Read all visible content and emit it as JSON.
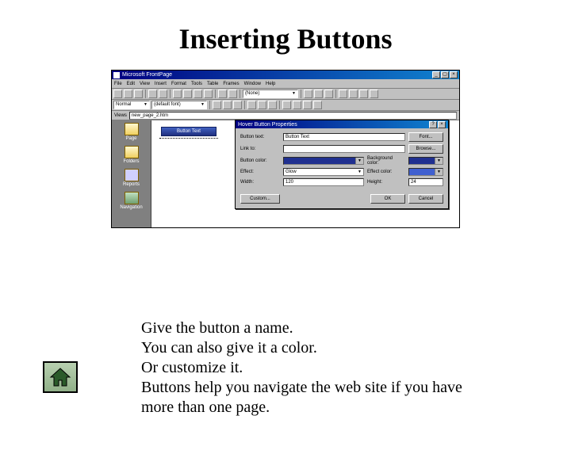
{
  "slide": {
    "title": "Inserting Buttons",
    "instructions": [
      "Give the button a name.",
      "You can also give it a color.",
      "Or customize it.",
      "Buttons help you navigate the web site if you have more than one page."
    ]
  },
  "app": {
    "title": "Microsoft FrontPage",
    "menus": [
      "File",
      "Edit",
      "View",
      "Insert",
      "Format",
      "Tools",
      "Table",
      "Frames",
      "Window",
      "Help"
    ],
    "toolbar2_dropdown": "(None)",
    "toolbar2_font": "(default font)",
    "toolbar2_size": "Normal",
    "address_label": "Views",
    "address_value": "new_page_2.htm",
    "views": [
      "Page",
      "Folders",
      "Reports",
      "Navigation"
    ],
    "button_preview_text": "Button Text"
  },
  "dialog": {
    "title": "Hover Button Properties",
    "labels": {
      "button_text": "Button text:",
      "link_to": "Link to:",
      "button_color": "Button color:",
      "background_color": "Background color:",
      "effect": "Effect:",
      "effect_color": "Effect color:",
      "width": "Width:",
      "height": "Height:"
    },
    "values": {
      "button_text": "Button Text",
      "link_to": "",
      "effect": "Glow",
      "width": "120",
      "height": "24"
    },
    "colors": {
      "button_color": "#203090",
      "background_color": "#203090",
      "effect_color": "#4060d0"
    },
    "buttons": {
      "font": "Font...",
      "browse": "Browse...",
      "custom": "Custom...",
      "ok": "OK",
      "cancel": "Cancel"
    }
  },
  "nav": {
    "home": "Home"
  }
}
